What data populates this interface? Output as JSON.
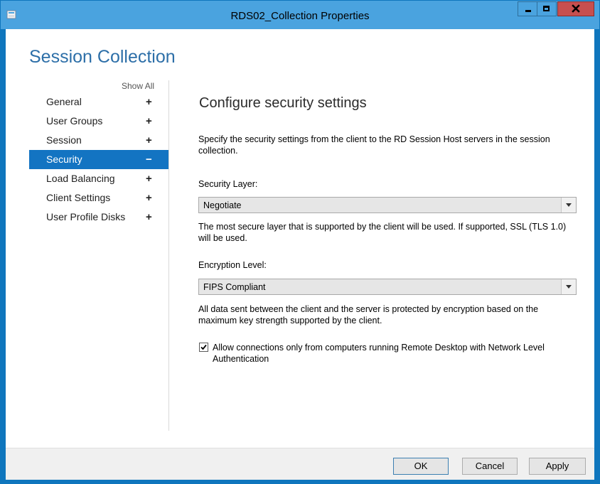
{
  "window": {
    "title": "RDS02_Collection Properties"
  },
  "heading": "Session Collection",
  "nav": {
    "show_all": "Show All",
    "items": [
      {
        "label": "General",
        "sign": "+"
      },
      {
        "label": "User Groups",
        "sign": "+"
      },
      {
        "label": "Session",
        "sign": "+"
      },
      {
        "label": "Security",
        "sign": "−",
        "selected": true
      },
      {
        "label": "Load Balancing",
        "sign": "+"
      },
      {
        "label": "Client Settings",
        "sign": "+"
      },
      {
        "label": "User Profile Disks",
        "sign": "+"
      }
    ]
  },
  "security": {
    "title": "Configure security settings",
    "description": "Specify the security settings from the client to the RD Session Host servers in the session collection.",
    "layer_label": "Security Layer:",
    "layer_value": "Negotiate",
    "layer_note": "The most secure layer that is supported by the client will be used. If supported, SSL (TLS 1.0) will be used.",
    "encryption_label": "Encryption Level:",
    "encryption_value": "FIPS Compliant",
    "encryption_note": "All data sent between the client and the server is protected by encryption based on the maximum key strength supported by the client.",
    "nla_checked": true,
    "nla_label": "Allow connections only from computers running Remote Desktop with Network Level Authentication"
  },
  "buttons": {
    "ok": "OK",
    "cancel": "Cancel",
    "apply": "Apply"
  },
  "colors": {
    "accent": "#1374c2",
    "heading": "#2d6fa8",
    "titlebar": "#4aa3df",
    "close": "#c74f4f"
  },
  "icons": {
    "app": "server-manager-icon",
    "minimize": "minimize-icon",
    "maximize": "maximize-icon",
    "close": "close-icon",
    "dropdown": "chevron-down-icon",
    "check": "checkmark-icon"
  }
}
